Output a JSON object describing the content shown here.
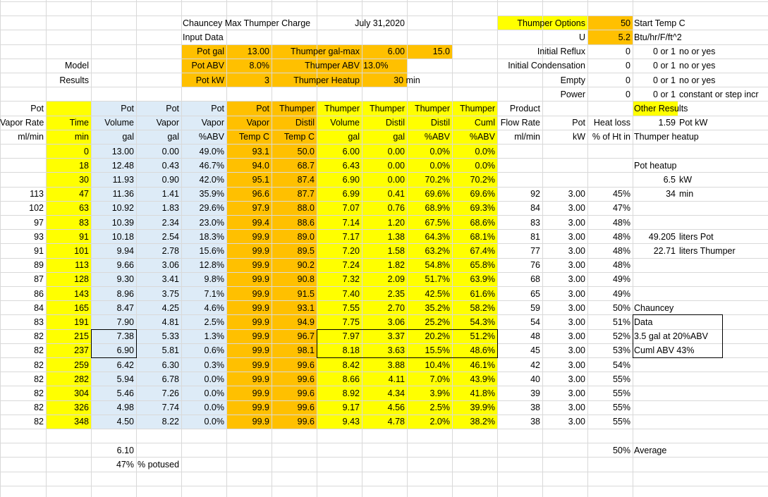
{
  "colors": {
    "yellow": "#ffff00",
    "orange": "#ffc000",
    "blue": "#ddebf7",
    "grid": "#d9d9d9"
  },
  "header": {
    "title": "Chauncey Max Thumper Charge",
    "date": "July 31,2020",
    "input_data": "Input Data",
    "model": "Model",
    "results": "Results"
  },
  "inputs": {
    "pot_gal": {
      "label": "Pot gal",
      "value": "13.00"
    },
    "pot_abv": {
      "label": "Pot ABV",
      "value": "8.0%"
    },
    "pot_kw": {
      "label": "Pot  kW",
      "value": "3"
    },
    "thumper_gal_max": {
      "label": "Thumper gal-max",
      "value": "6.00",
      "extra": "15.0"
    },
    "thumper_abv": {
      "label": "Thumper ABV",
      "value": "13.0%"
    },
    "thumper_heatup": {
      "label": "Thumper Heatup",
      "value": "30 min"
    }
  },
  "options": {
    "title": "Thumper Options",
    "start_temp": {
      "value": "50",
      "desc": "Start Temp C"
    },
    "u": {
      "label": "U",
      "value": "5.2",
      "desc": "Btu/hr/F/ft^2"
    },
    "initial_reflux": {
      "label": "Initial Reflux",
      "value": "0",
      "desc1": "0 or 1",
      "desc2": "no or yes"
    },
    "initial_condensation": {
      "label": "Initial Condensation",
      "value": "0",
      "desc1": "0 or 1",
      "desc2": "no or yes"
    },
    "empty": {
      "label": "Empty",
      "value": "0",
      "desc1": "0 or 1",
      "desc2": "no or yes"
    },
    "power": {
      "label": "Power",
      "value": "0",
      "desc1": "0 or 1",
      "desc2": "constant or step incr"
    }
  },
  "other_results": {
    "title": "Other Results",
    "pot_kw_value": "1.59",
    "pot_kw_unit": "Pot kW",
    "thumper_heatup": "Thumper heatup",
    "pot_heatup": "Pot heatup",
    "pot_heatup_kw": "6.5",
    "kw_unit": "kW",
    "minutes": "34",
    "min_unit": "min",
    "liters_pot": "49.205",
    "liters_pot_label": "liters  Pot",
    "liters_thumper": "22.71",
    "liters_thumper_label": "liters  Thumper",
    "chauncey": "Chauncey",
    "data": "Data",
    "note1": "3.5 gal at 20%ABV",
    "note2": "Cuml ABV 43%"
  },
  "column_headers": {
    "row1": [
      "Pot",
      "",
      "Pot",
      "Pot",
      "Pot",
      "Pot",
      "Thumper",
      "Thumper",
      "Thumper",
      "Thumper",
      "Thumper",
      "Product",
      "",
      ""
    ],
    "row2": [
      "Vapor Rate",
      "Time",
      "Volume",
      "Vapor",
      "Vapor",
      "Vapor",
      "Distil",
      "Volume",
      "Distil",
      "Distil",
      "Cuml",
      "Flow Rate",
      "Pot",
      "Heat loss"
    ],
    "row3": [
      "ml/min",
      "min",
      "gal",
      "gal",
      "%ABV",
      "Temp  C",
      "Temp  C",
      "gal",
      "gal",
      "%ABV",
      "%ABV",
      "ml/min",
      "kW",
      "% of Ht in"
    ]
  },
  "rows": [
    [
      "",
      "0",
      "13.00",
      "0.00",
      "49.0%",
      "93.1",
      "50.0",
      "6.00",
      "0.00",
      "0.0%",
      "0.0%",
      "",
      "",
      ""
    ],
    [
      "",
      "18",
      "12.48",
      "0.43",
      "46.7%",
      "94.0",
      "68.7",
      "6.43",
      "0.00",
      "0.0%",
      "0.0%",
      "",
      "",
      ""
    ],
    [
      "",
      "30",
      "11.93",
      "0.90",
      "42.0%",
      "95.1",
      "87.4",
      "6.90",
      "0.00",
      "70.2%",
      "70.2%",
      "",
      "",
      ""
    ],
    [
      "113",
      "47",
      "11.36",
      "1.41",
      "35.9%",
      "96.6",
      "87.7",
      "6.99",
      "0.41",
      "69.6%",
      "69.6%",
      "92",
      "3.00",
      "45%"
    ],
    [
      "102",
      "63",
      "10.92",
      "1.83",
      "29.6%",
      "97.9",
      "88.0",
      "7.07",
      "0.76",
      "68.9%",
      "69.3%",
      "84",
      "3.00",
      "47%"
    ],
    [
      "97",
      "83",
      "10.39",
      "2.34",
      "23.0%",
      "99.4",
      "88.6",
      "7.14",
      "1.20",
      "67.5%",
      "68.6%",
      "83",
      "3.00",
      "48%"
    ],
    [
      "93",
      "91",
      "10.18",
      "2.54",
      "18.3%",
      "99.9",
      "89.0",
      "7.17",
      "1.38",
      "64.3%",
      "68.1%",
      "81",
      "3.00",
      "48%"
    ],
    [
      "91",
      "101",
      "9.94",
      "2.78",
      "15.6%",
      "99.9",
      "89.5",
      "7.20",
      "1.58",
      "63.2%",
      "67.4%",
      "77",
      "3.00",
      "48%"
    ],
    [
      "89",
      "113",
      "9.66",
      "3.06",
      "12.8%",
      "99.9",
      "90.2",
      "7.24",
      "1.82",
      "54.8%",
      "65.8%",
      "76",
      "3.00",
      "48%"
    ],
    [
      "87",
      "128",
      "9.30",
      "3.41",
      "9.8%",
      "99.9",
      "90.8",
      "7.32",
      "2.09",
      "51.7%",
      "63.9%",
      "68",
      "3.00",
      "49%"
    ],
    [
      "86",
      "143",
      "8.96",
      "3.75",
      "7.1%",
      "99.9",
      "91.5",
      "7.40",
      "2.35",
      "42.5%",
      "61.6%",
      "65",
      "3.00",
      "49%"
    ],
    [
      "84",
      "165",
      "8.47",
      "4.25",
      "4.6%",
      "99.9",
      "93.1",
      "7.55",
      "2.70",
      "35.2%",
      "58.2%",
      "59",
      "3.00",
      "50%"
    ],
    [
      "83",
      "191",
      "7.90",
      "4.81",
      "2.5%",
      "99.9",
      "94.9",
      "7.75",
      "3.06",
      "25.2%",
      "54.3%",
      "54",
      "3.00",
      "51%"
    ],
    [
      "82",
      "215",
      "7.38",
      "5.33",
      "1.3%",
      "99.9",
      "96.7",
      "7.97",
      "3.37",
      "20.2%",
      "51.2%",
      "48",
      "3.00",
      "52%"
    ],
    [
      "82",
      "237",
      "6.90",
      "5.81",
      "0.6%",
      "99.9",
      "98.1",
      "8.18",
      "3.63",
      "15.5%",
      "48.6%",
      "45",
      "3.00",
      "53%"
    ],
    [
      "82",
      "259",
      "6.42",
      "6.30",
      "0.3%",
      "99.9",
      "99.6",
      "8.42",
      "3.88",
      "10.4%",
      "46.1%",
      "42",
      "3.00",
      "54%"
    ],
    [
      "82",
      "282",
      "5.94",
      "6.78",
      "0.0%",
      "99.9",
      "99.6",
      "8.66",
      "4.11",
      "7.0%",
      "43.9%",
      "40",
      "3.00",
      "55%"
    ],
    [
      "82",
      "304",
      "5.46",
      "7.26",
      "0.0%",
      "99.9",
      "99.6",
      "8.92",
      "4.34",
      "3.9%",
      "41.8%",
      "39",
      "3.00",
      "55%"
    ],
    [
      "82",
      "326",
      "4.98",
      "7.74",
      "0.0%",
      "99.9",
      "99.6",
      "9.17",
      "4.56",
      "2.5%",
      "39.9%",
      "38",
      "3.00",
      "55%"
    ],
    [
      "82",
      "348",
      "4.50",
      "8.22",
      "0.0%",
      "99.9",
      "99.6",
      "9.43",
      "4.78",
      "2.0%",
      "38.2%",
      "38",
      "3.00",
      "55%"
    ]
  ],
  "footer": {
    "total": "6.10",
    "percent": "47%",
    "percent_label": "% potused",
    "avg_value": "50%",
    "avg_label": "Average"
  }
}
